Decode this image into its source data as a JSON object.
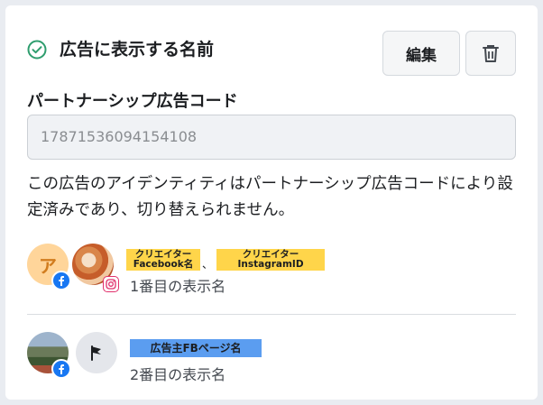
{
  "header": {
    "title": "広告に表示する名前",
    "edit_label": "編集"
  },
  "partnership_code": {
    "label": "パートナーシップ広告コード",
    "value": "17871536094154108"
  },
  "notice": "この広告のアイデンティティはパートナーシップ広告コードにより設定済みであり、切り替えられません。",
  "identities": [
    {
      "avatar_letter": "ア",
      "tag_facebook": [
        "クリエイター",
        "Facebook名"
      ],
      "separator": "、",
      "tag_instagram": [
        "クリエイター",
        "InstagramID"
      ],
      "display_name": "1番目の表示名"
    },
    {
      "tag_page": "広告主FBページ名",
      "display_name": "2番目の表示名"
    }
  ],
  "colors": {
    "check": "#2e9d6e",
    "facebook": "#1877f2",
    "instagram": "#e1306c",
    "tag_yellow": "#ffd54a",
    "tag_blue": "#5b9df0"
  },
  "icons": [
    "check-circle-icon",
    "trash-icon",
    "facebook-icon",
    "instagram-icon",
    "flag-icon"
  ]
}
